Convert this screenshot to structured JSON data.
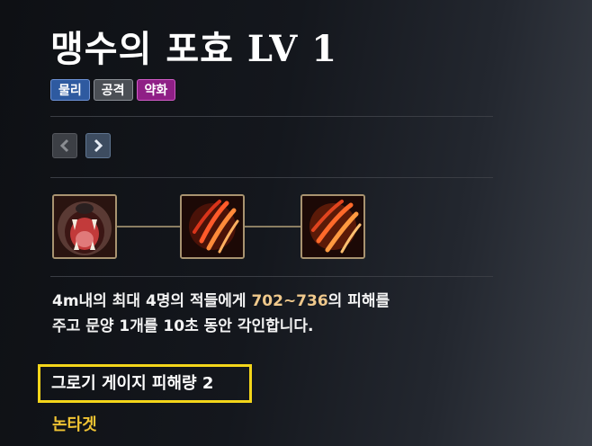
{
  "skill": {
    "name": "맹수의 포효 LV 1",
    "tags": [
      "물리",
      "공격",
      "약화"
    ]
  },
  "navigation": {
    "prev_icon": "chevron-left-icon",
    "next_icon": "chevron-right-icon"
  },
  "skill_chain": [
    {
      "icon": "beast-roar-icon"
    },
    {
      "icon": "claw-slash-icon"
    },
    {
      "icon": "claw-slash-icon"
    }
  ],
  "description": {
    "part1": "4m내의 최대 4명의 적들에게 ",
    "damage": "702~736",
    "part2": "의 피해를",
    "line2": "주고 문양 1개를 10초 동안 각인합니다."
  },
  "effect": "그로기 게이지 피해량 2",
  "target_type": "논타겟",
  "colors": {
    "tag_physical": "#2e5aa0",
    "tag_attack": "#4b4f55",
    "tag_weaken": "#8f1f86",
    "damage_highlight": "#f0c98c",
    "effect_border": "#f3d51a",
    "target_type": "#f0c433"
  }
}
